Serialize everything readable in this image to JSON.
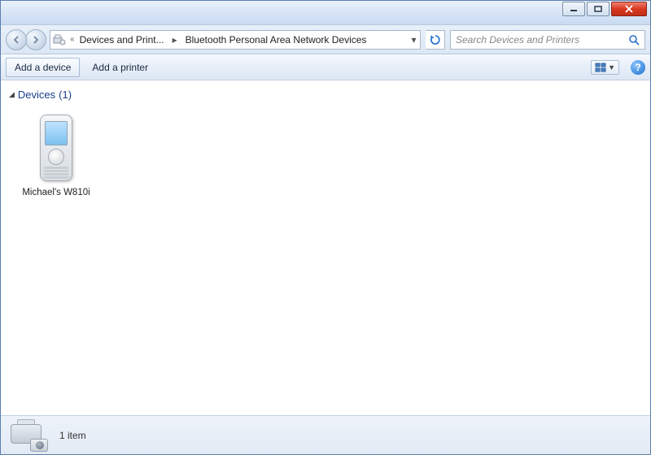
{
  "breadcrumb": {
    "overflow_indicator": "«",
    "parts": [
      "Devices and Print...",
      "Bluetooth Personal Area Network Devices"
    ]
  },
  "search": {
    "placeholder": "Search Devices and Printers"
  },
  "toolbar": {
    "add_device": "Add a device",
    "add_printer": "Add a printer"
  },
  "group": {
    "label": "Devices",
    "count": "(1)"
  },
  "items": [
    {
      "name": "Michael's W810i"
    }
  ],
  "status": {
    "count_text": "1 item"
  }
}
